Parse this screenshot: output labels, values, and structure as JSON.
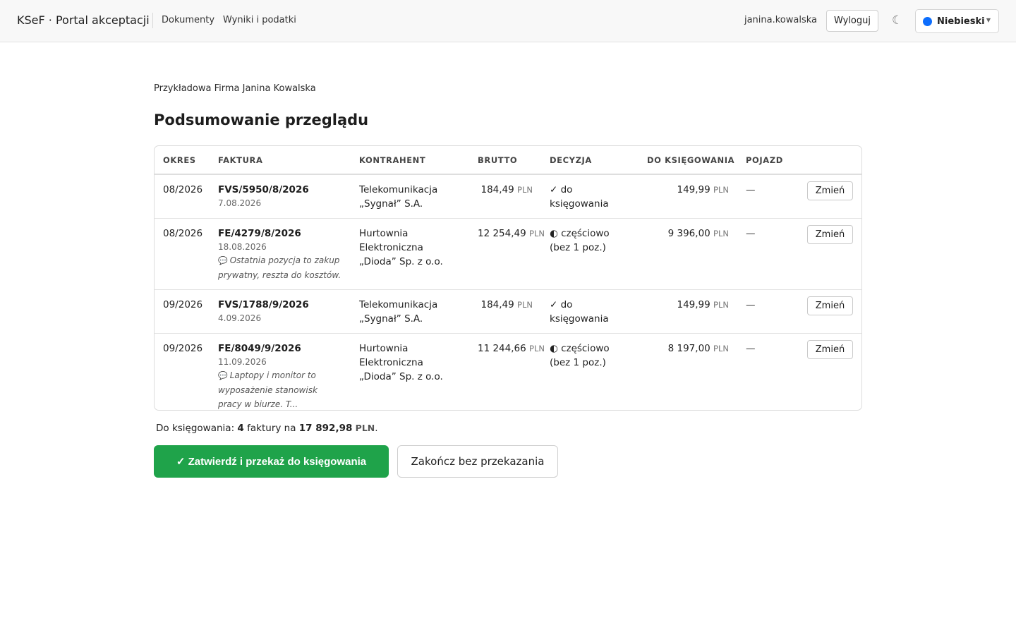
{
  "header": {
    "brand": "KSeF · Portal akceptacji",
    "nav": [
      {
        "label": "Dokumenty"
      },
      {
        "label": "Wyniki i podatki"
      }
    ],
    "username": "janina.kowalska",
    "logout_label": "Wyloguj",
    "theme_icon": "moon-icon",
    "theme": {
      "label": "Niebieski",
      "color": "#0d6efd"
    }
  },
  "company": "Przykładowa Firma Janina Kowalska",
  "title": "Podsumowanie przeglądu",
  "table": {
    "columns": {
      "period": "OKRES",
      "invoice": "FAKTURA",
      "contractor": "KONTRAHENT",
      "gross": "BRUTTO",
      "decision": "DECYZJA",
      "to_post": "DO KSIĘGOWANIA",
      "vehicle": "POJAZD"
    },
    "currency": "PLN",
    "rows": [
      {
        "period": "08/2026",
        "invoice_no": "FVS/5950/8/2026",
        "invoice_date": "7.08.2026",
        "note": "",
        "contractor": "Telekomunikacja „Sygnał” S.A.",
        "gross": "184,49",
        "decision": "✓ do księgowania",
        "to_post": "149,99",
        "vehicle": "—",
        "action": "Zmień"
      },
      {
        "period": "08/2026",
        "invoice_no": "FE/4279/8/2026",
        "invoice_date": "18.08.2026",
        "note": "Ostatnia pozycja to zakup prywatny, reszta do kosztów.",
        "contractor": "Hurtownia Elektroniczna „Dioda” Sp. z o.o.",
        "gross": "12 254,49",
        "decision": "◐ częściowo (bez 1 poz.)",
        "to_post": "9 396,00",
        "vehicle": "—",
        "action": "Zmień"
      },
      {
        "period": "09/2026",
        "invoice_no": "FVS/1788/9/2026",
        "invoice_date": "4.09.2026",
        "note": "",
        "contractor": "Telekomunikacja „Sygnał” S.A.",
        "gross": "184,49",
        "decision": "✓ do księgowania",
        "to_post": "149,99",
        "vehicle": "—",
        "action": "Zmień"
      },
      {
        "period": "09/2026",
        "invoice_no": "FE/8049/9/2026",
        "invoice_date": "11.09.2026",
        "note": "Laptopy i monitor to wyposażenie stanowisk pracy w biurze. T...",
        "contractor": "Hurtownia Elektroniczna „Dioda” Sp. z o.o.",
        "gross": "11 244,66",
        "decision": "◐ częściowo (bez 1 poz.)",
        "to_post": "8 197,00",
        "vehicle": "—",
        "action": "Zmień"
      }
    ]
  },
  "summary": {
    "prefix": "Do księgowania:",
    "count": "4",
    "middle": "faktury na",
    "total": "17 892,98",
    "currency": "PLN",
    "suffix": "."
  },
  "buttons": {
    "confirm": "✓ Zatwierdź i przekaż do księgowania",
    "finish": "Zakończ bez przekazania"
  }
}
